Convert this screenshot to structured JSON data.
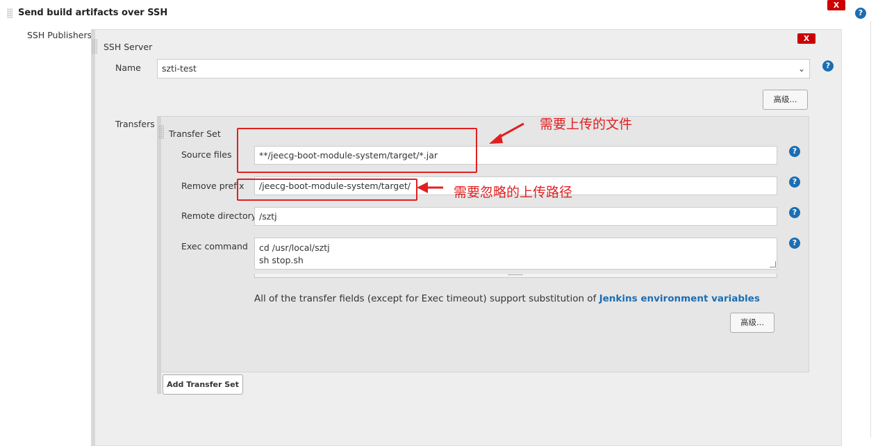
{
  "section": {
    "title": "Send build artifacts over SSH",
    "delete_label": "X"
  },
  "publishers": {
    "label": "SSH Publishers",
    "server": {
      "label": "SSH Server",
      "delete_label": "X",
      "name_label": "Name",
      "name_value": "szti-test",
      "advanced_label": "高级...",
      "transfers_label": "Transfers",
      "transfer_set": {
        "label": "Transfer Set",
        "source_files_label": "Source files",
        "source_files_value": "**/jeecg-boot-module-system/target/*.jar",
        "remove_prefix_label": "Remove prefix",
        "remove_prefix_value": "/jeecg-boot-module-system/target/",
        "remote_directory_label": "Remote directory",
        "remote_directory_value": "/sztj",
        "exec_command_label": "Exec command",
        "exec_command_value": "cd /usr/local/sztj\nsh stop.sh",
        "note_text": "All of the transfer fields (except for Exec timeout) support substitution of ",
        "note_link": "Jenkins environment variables",
        "advanced_label": "高级..."
      },
      "add_transfer_set_label": "Add Transfer Set"
    }
  },
  "annotations": {
    "upload_files": "需要上传的文件",
    "ignore_path": "需要忽略的上传路径"
  },
  "help_icon_glyph": "?",
  "colors": {
    "accent_link": "#1a6eb4",
    "delete_red": "#cc0000",
    "annotation_red": "#e02020"
  }
}
